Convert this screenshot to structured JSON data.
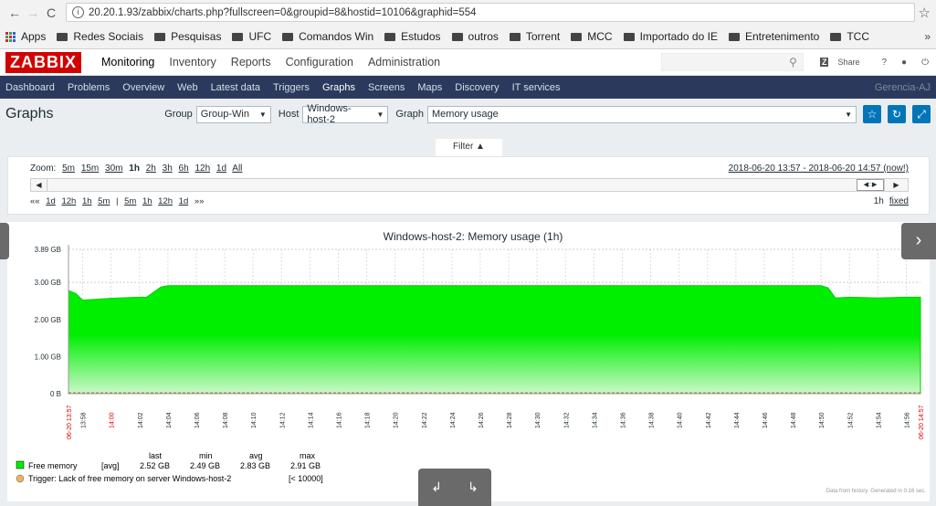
{
  "browser": {
    "back": "←",
    "forward": "→",
    "reload": "C",
    "url": "20.20.1.93/zabbix/charts.php?fullscreen=0&groupid=8&hostid=10106&graphid=554",
    "bookmarks": [
      "Apps",
      "Redes Sociais",
      "Pesquisas",
      "UFC",
      "Comandos Win",
      "Estudos",
      "outros",
      "Torrent",
      "MCC",
      "Importado do IE",
      "Entretenimento",
      "TCC"
    ],
    "more": "»"
  },
  "app": {
    "logo": "ZABBIX",
    "menu": [
      "Monitoring",
      "Inventory",
      "Reports",
      "Configuration",
      "Administration"
    ],
    "share": "Share",
    "help": "?",
    "user_icon": "user-icon",
    "logout_icon": "power-icon"
  },
  "subnav": {
    "items": [
      "Dashboard",
      "Problems",
      "Overview",
      "Web",
      "Latest data",
      "Triggers",
      "Graphs",
      "Screens",
      "Maps",
      "Discovery",
      "IT services"
    ],
    "right": "Gerencia-AJ"
  },
  "page": {
    "title": "Graphs",
    "group_label": "Group",
    "group_value": "Group-Win",
    "host_label": "Host",
    "host_value": "Windows-host-2",
    "graph_label": "Graph",
    "graph_value": "Memory usage"
  },
  "filter": {
    "tab_label": "Filter ▲",
    "zoom_label": "Zoom:",
    "zoom": [
      "5m",
      "15m",
      "30m",
      "1h",
      "2h",
      "3h",
      "6h",
      "12h",
      "1d",
      "All"
    ],
    "period": "2018-06-20 13:57 - 2018-06-20 14:57 (now!)",
    "nav": [
      "««",
      "1d",
      "12h",
      "1h",
      "5m",
      "|",
      "5m",
      "1h",
      "12h",
      "1d",
      "»»"
    ],
    "period_len": "1h",
    "fixed": "fixed"
  },
  "chart_data": {
    "type": "area",
    "title": "Windows-host-2: Memory usage (1h)",
    "ylabels": [
      "3.89 GB",
      "3.00 GB",
      "2.00 GB",
      "1.00 GB",
      "0 B"
    ],
    "ylim": [
      0,
      3.89
    ],
    "x_start_label": "06-20 13:57",
    "x_end_label": "06-20 14:57",
    "x_ticks": [
      "13:58",
      "14:00",
      "14:02",
      "14:04",
      "14:06",
      "14:08",
      "14:10",
      "14:12",
      "14:14",
      "14:16",
      "14:18",
      "14:20",
      "14:22",
      "14:24",
      "14:26",
      "14:28",
      "14:30",
      "14:32",
      "14:34",
      "14:36",
      "14:38",
      "14:40",
      "14:42",
      "14:44",
      "14:46",
      "14:48",
      "14:50",
      "14:52",
      "14:54",
      "14:56"
    ],
    "series": [
      {
        "name": "Free memory",
        "color": "#00EE00",
        "x": [
          "13:57",
          "13:57:30",
          "13:58",
          "14:00",
          "14:02",
          "14:02:30",
          "14:03:30",
          "14:04",
          "14:50",
          "14:50:30",
          "14:51",
          "14:52",
          "14:54",
          "14:56",
          "14:57"
        ],
        "values": [
          2.78,
          2.7,
          2.52,
          2.57,
          2.6,
          2.6,
          2.87,
          2.91,
          2.91,
          2.85,
          2.58,
          2.6,
          2.58,
          2.6,
          2.6
        ]
      }
    ],
    "legend": {
      "head": [
        "last",
        "min",
        "avg",
        "max"
      ],
      "rows": [
        {
          "name": "Free memory",
          "func": "[avg]",
          "last": "2.52 GB",
          "min": "2.49 GB",
          "avg": "2.83 GB",
          "max": "2.91 GB"
        }
      ],
      "trigger": "Trigger: Lack of free memory on server Windows-host-2",
      "trigger_cond": "[< 10000]"
    },
    "footer": "Data from history. Generated in 0.16 sec."
  }
}
